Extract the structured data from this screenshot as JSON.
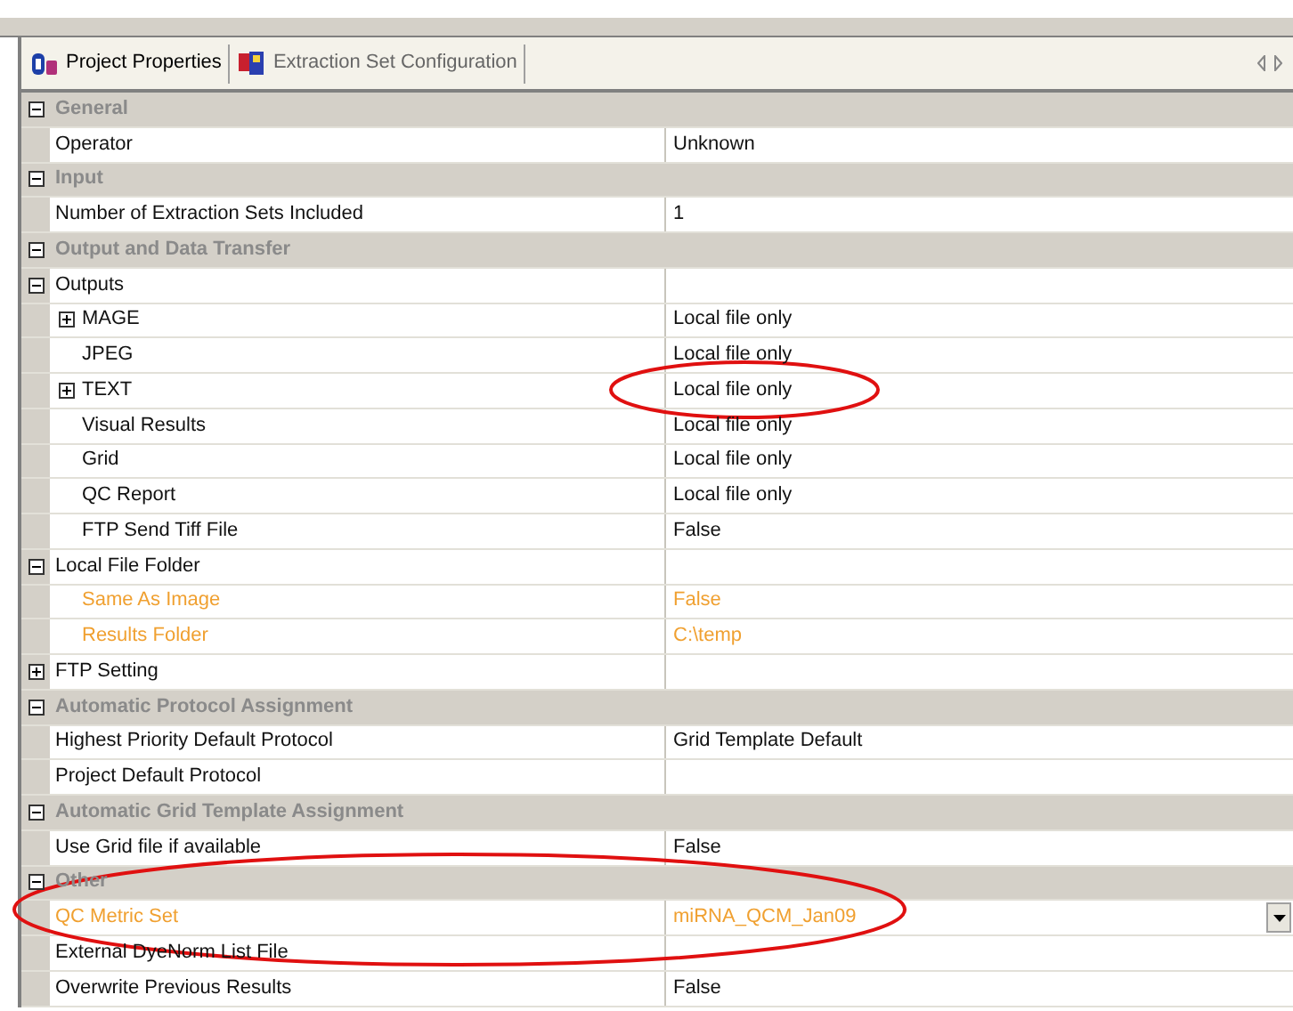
{
  "tabs": [
    {
      "label": "Project Properties",
      "selected": true
    },
    {
      "label": "Extraction Set Configuration",
      "selected": false
    }
  ],
  "categories": [
    {
      "label": "General",
      "expanded": true,
      "properties": [
        {
          "name": "Operator",
          "value": "Unknown"
        }
      ]
    },
    {
      "label": "Input",
      "expanded": true,
      "properties": [
        {
          "name": "Number of Extraction Sets Included",
          "value": "1"
        }
      ]
    },
    {
      "label": "Output and Data Transfer",
      "expanded": true,
      "properties": [
        {
          "name": "Outputs",
          "expanded": true,
          "children": [
            {
              "name": "MAGE",
              "value": "Local file only",
              "expanded": false
            },
            {
              "name": "JPEG",
              "value": "Local file only"
            },
            {
              "name": "TEXT",
              "value": "Local file only",
              "expanded": false,
              "value_circled": true
            },
            {
              "name": "Visual Results",
              "value": "Local file only"
            },
            {
              "name": "Grid",
              "value": "Local file only"
            },
            {
              "name": "QC Report",
              "value": "Local file only"
            },
            {
              "name": "FTP Send Tiff File",
              "value": "False"
            }
          ]
        },
        {
          "name": "Local File Folder",
          "expanded": true,
          "children": [
            {
              "name": "Same As Image",
              "value": "False",
              "modified": true
            },
            {
              "name": "Results Folder",
              "value": "C:\\temp",
              "modified": true
            }
          ]
        },
        {
          "name": "FTP Setting",
          "expanded": false
        }
      ]
    },
    {
      "label": "Automatic Protocol Assignment",
      "expanded": true,
      "properties": [
        {
          "name": "Highest Priority Default Protocol",
          "value": "Grid Template Default"
        },
        {
          "name": "Project Default Protocol"
        }
      ]
    },
    {
      "label": "Automatic Grid Template Assignment",
      "expanded": true,
      "properties": [
        {
          "name": "Use Grid file if available",
          "value": "False"
        }
      ]
    },
    {
      "label": "Other",
      "expanded": true,
      "properties": [
        {
          "name": "QC Metric Set",
          "value": "miRNA_QCM_Jan09",
          "modified": true,
          "dropdown": true,
          "row_circled": true
        },
        {
          "name": "External DyeNorm List File"
        },
        {
          "name": "Overwrite Previous Results",
          "value": "False"
        }
      ]
    }
  ]
}
